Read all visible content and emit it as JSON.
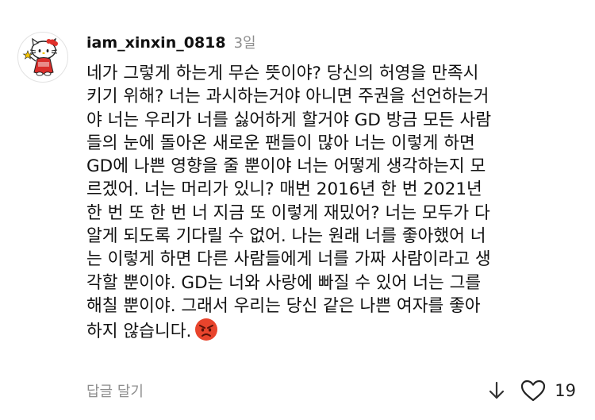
{
  "comment": {
    "username": "iam_xinxin_0818",
    "time": "3일",
    "lines": [
      "네가 그렇게 하는게 무슨 뜻이야? 당신의 허영을 만족시",
      "키기 위해? 너는 과시하는거야 아니면 주권을 선언하는거",
      "야 너는 우리가 너를 싫어하게 할거야 GD 방금 모든 사람",
      "들의 눈에 돌아온 새로운 팬들이 많아 너는 이렇게 하면",
      "GD에 나쁜 영향을 줄 뿐이야 너는 어떻게 생각하는지 모",
      "르겠어. 너는 머리가 있니? 매번 2016년 한 번 2021년",
      "한 번 또 한 번 너 지금 또 이렇게 재밌어? 너는 모두가 다",
      "알게 되도록 기다릴 수 없어. 나는 원래 너를 좋아했어 너",
      "는 이렇게 하면 다른 사람들에게 너를 가짜 사람이라고 생",
      "각할 뿐이야. GD는 너와 사랑에 빠질 수 있어 너는 그를",
      "해칠 뿐이야. 그래서 우리는 당신 같은 나쁜 여자를 좋아",
      "하지 않습니다."
    ],
    "trailing_emoji": "angry-face-icon",
    "reply_label": "답글 달기",
    "like_count": "19"
  },
  "avatar_icon": "hello-kitty-avatar",
  "colors": {
    "text": "#111111",
    "muted": "#8e8e8e",
    "emoji_face": "#e8442c"
  }
}
